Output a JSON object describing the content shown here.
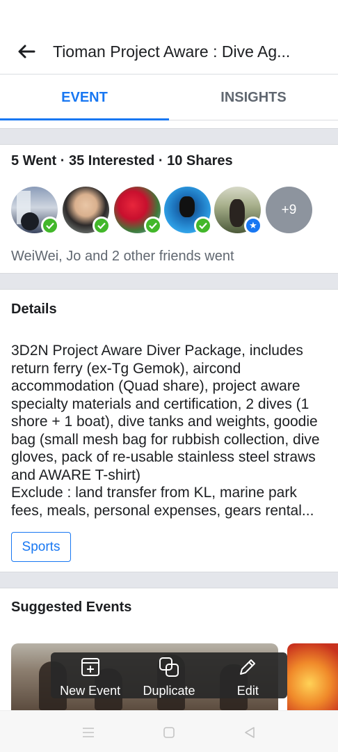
{
  "header": {
    "title": "Tioman Project Aware : Dive Ag...",
    "back_icon": "arrow-left-icon"
  },
  "tabs": [
    {
      "label": "EVENT",
      "active": true
    },
    {
      "label": "INSIGHTS",
      "active": false
    }
  ],
  "stats": "5 Went · 35 Interested · 10 Shares",
  "avatars": {
    "badges": [
      "check",
      "check",
      "check",
      "check",
      "star"
    ],
    "more_label": "+9"
  },
  "friends_text": "WeiWei, Jo and 2 other friends went",
  "details": {
    "heading": "Details",
    "description": "3D2N Project Aware Diver Package, includes return ferry (ex-Tg Gemok), aircond accommodation (Quad share), project aware specialty materials and certification, 2 dives (1 shore + 1 boat), dive tanks and weights, goodie bag (small mesh bag for rubbish collection, dive gloves, pack of re-usable stainless steel straws and AWARE T-shirt)\nExclude : land transfer from KL, marine park fees, meals, personal expenses, gears rental...",
    "tag": "Sports"
  },
  "suggested": {
    "heading": "Suggested Events"
  },
  "actions": [
    {
      "label": "New Event",
      "icon": "new-event-icon"
    },
    {
      "label": "Duplicate",
      "icon": "duplicate-icon"
    },
    {
      "label": "Edit",
      "icon": "pencil-icon"
    }
  ],
  "colors": {
    "accent": "#1877f2",
    "going_badge": "#42b72a",
    "divider": "#e4e6eb"
  }
}
